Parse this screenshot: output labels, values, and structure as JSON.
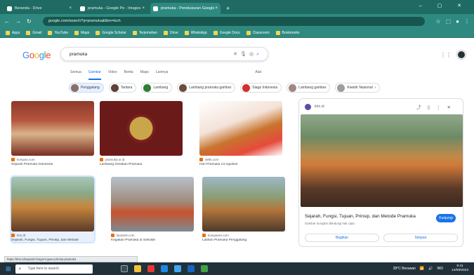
{
  "browser": {
    "tabs": [
      {
        "label": "Beranda - Drive"
      },
      {
        "label": "pramuka - Google Pe - Images"
      },
      {
        "label": "pramuka - Penelusuran Google"
      }
    ],
    "new_tab": "+",
    "window_controls": "–  ▢  ✕",
    "address": "google.com/search?q=pramuka&tbm=isch",
    "bookmarks": [
      "Apps",
      "Gmail",
      "YouTube",
      "Maps",
      "Google Scholar",
      "Terjemahan",
      "Drive",
      "WhatsApp",
      "Google Docs",
      "Classroom",
      "Bookmarks"
    ]
  },
  "google": {
    "logo": {
      "G": "G",
      "o1": "o",
      "o2": "o",
      "g": "g",
      "l": "l",
      "e": "e"
    },
    "query": "pramuka",
    "nav_tabs": [
      "Semua",
      "Gambar",
      "Video",
      "Berita",
      "Maps",
      "Lainnya"
    ],
    "tools": "Alat",
    "chips": [
      {
        "label": "Penggalang",
        "color": "#8d6e63",
        "selected": true
      },
      {
        "label": "Tantara",
        "color": "#5d4037",
        "selected": false
      },
      {
        "label": "Lambang",
        "color": "#2e7d32",
        "selected": false
      },
      {
        "label": "Lambang pramuka gambar",
        "color": "#6d4c41",
        "selected": false
      },
      {
        "label": "Siaga Indonesia",
        "color": "#d32f2f",
        "selected": false
      },
      {
        "label": "Lambang gambar",
        "color": "#a1887f",
        "selected": false
      },
      {
        "label": "Kwartir Nasional",
        "color": "#9e9e9e",
        "selected": false
      }
    ]
  },
  "results": [
    {
      "source": "kompas.com",
      "title": "Sejarah Pramuka Indonesia"
    },
    {
      "source": "pramuka.or.id",
      "title": "Lambang Gerakan Pramuka"
    },
    {
      "source": "detik.com",
      "title": "Hari Pramuka 14 Agustus"
    },
    {
      "source": "tirto.id",
      "title": "Sejarah, Fungsi, Tujuan, Prinsip, dan Metode"
    },
    {
      "source": "liputan6.com",
      "title": "Kegiatan Pramuka di Sekolah"
    },
    {
      "source": "kumparan.com",
      "title": "Latihan Pramuka Penggalang"
    }
  ],
  "panel": {
    "source": "tirto.id",
    "title": "Sejarah, Fungsi, Tujuan, Prinsip, dan Metode Pramuka",
    "visit": "Kunjungi",
    "note": "Gambar mungkin dilindungi hak cipta.",
    "share": "Bagikan",
    "save": "Simpan"
  },
  "status_text": "https://tirto.id/sejarah-fungsi-tujuan-prinsip-pramuka",
  "taskbar": {
    "search_placeholder": "Type here to search",
    "weather": "28°C Berawan",
    "lang": "IND",
    "time": "9:41",
    "date": "14/08/2023"
  }
}
